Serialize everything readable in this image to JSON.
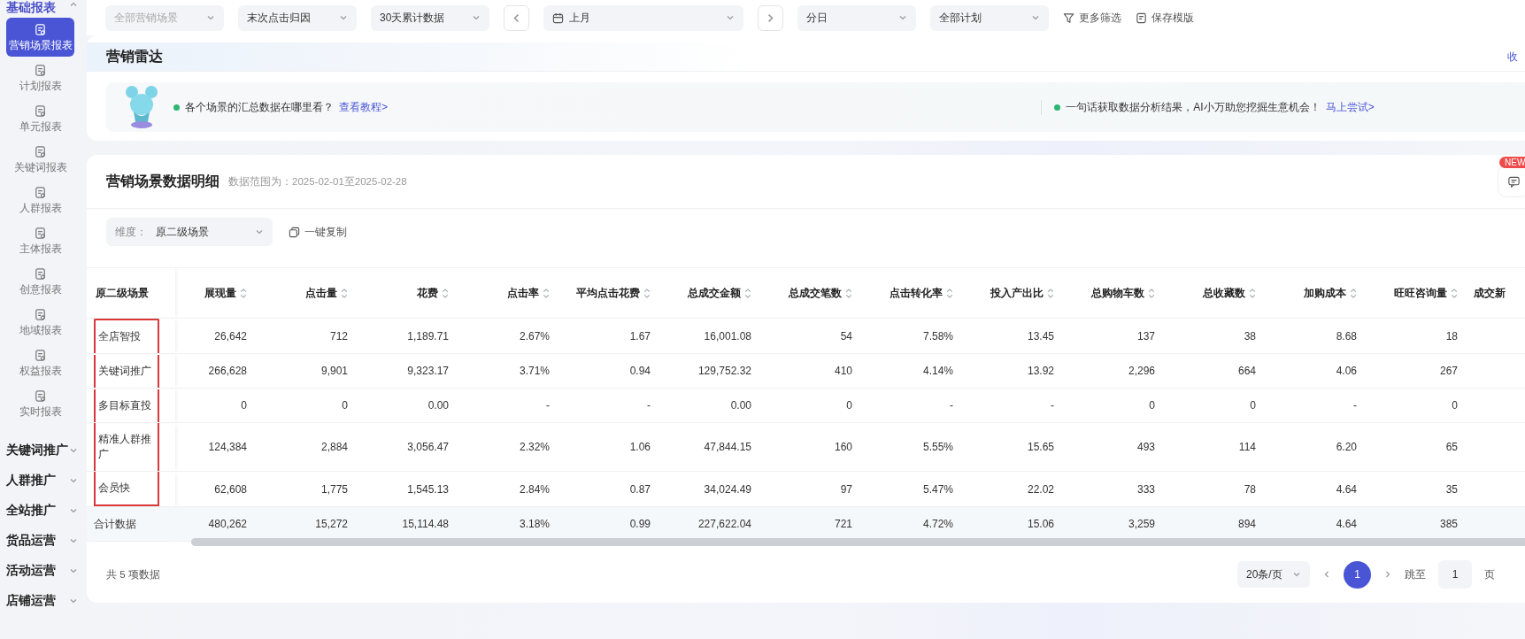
{
  "sidebar": {
    "groups": [
      {
        "label": "基础报表",
        "expanded": true,
        "items": [
          {
            "label": "营销场景报表",
            "selected": true
          },
          {
            "label": "计划报表",
            "selected": false
          },
          {
            "label": "单元报表",
            "selected": false
          },
          {
            "label": "关键词报表",
            "selected": false
          },
          {
            "label": "人群报表",
            "selected": false
          },
          {
            "label": "主体报表",
            "selected": false
          },
          {
            "label": "创意报表",
            "selected": false
          },
          {
            "label": "地域报表",
            "selected": false
          },
          {
            "label": "权益报表",
            "selected": false
          },
          {
            "label": "实时报表",
            "selected": false
          }
        ]
      },
      {
        "label": "关键词推广",
        "expanded": false
      },
      {
        "label": "人群推广",
        "expanded": false
      },
      {
        "label": "全站推广",
        "expanded": false
      },
      {
        "label": "货品运营",
        "expanded": false
      },
      {
        "label": "活动运营",
        "expanded": false
      },
      {
        "label": "店铺运营",
        "expanded": false
      }
    ]
  },
  "filters": [
    {
      "kind": "select",
      "value": "全部营销场景",
      "disabled": true
    },
    {
      "kind": "select",
      "value": "末次点击归因",
      "disabled": false
    },
    {
      "kind": "select",
      "value": "30天累计数据",
      "disabled": false
    },
    {
      "kind": "prev"
    },
    {
      "kind": "date",
      "value": "上月",
      "disabled": false
    },
    {
      "kind": "next"
    },
    {
      "kind": "select",
      "value": "分日",
      "disabled": false
    },
    {
      "kind": "select",
      "value": "全部计划",
      "disabled": false
    },
    {
      "kind": "filter",
      "label": "更多筛选"
    },
    {
      "kind": "save",
      "label": "保存模版"
    }
  ],
  "radar": {
    "title": "营销雷达",
    "collapse": "收",
    "tips": [
      {
        "text": "各个场景的汇总数据在哪里看？",
        "link": "查看教程>"
      },
      {
        "text": "一句话获取数据分析结果，AI小万助您挖掘生意机会！",
        "link": "马上尝试>"
      }
    ]
  },
  "detail": {
    "title": "营销场景数据明细",
    "range": "数据范围为：2025-02-01至2025-02-28",
    "badge": "NEW",
    "dimension": {
      "label": "维度：",
      "value": "原二级场景"
    },
    "copy": "一键复制",
    "table": {
      "columns": [
        {
          "label": "原二级场景",
          "sortable": false
        },
        {
          "label": "展现量",
          "sortable": true
        },
        {
          "label": "点击量",
          "sortable": true
        },
        {
          "label": "花费",
          "sortable": true
        },
        {
          "label": "点击率",
          "sortable": true
        },
        {
          "label": "平均点击花费",
          "sortable": true
        },
        {
          "label": "总成交金额",
          "sortable": true
        },
        {
          "label": "总成交笔数",
          "sortable": true
        },
        {
          "label": "点击转化率",
          "sortable": true
        },
        {
          "label": "投入产出比",
          "sortable": true
        },
        {
          "label": "总购物车数",
          "sortable": true
        },
        {
          "label": "总收藏数",
          "sortable": true
        },
        {
          "label": "加购成本",
          "sortable": true
        },
        {
          "label": "旺旺咨询量",
          "sortable": true
        },
        {
          "label": "成交新",
          "sortable": false
        }
      ],
      "rows": [
        {
          "scene": "全店智投",
          "highlighted": true,
          "values": [
            "26,642",
            "712",
            "1,189.71",
            "2.67%",
            "1.67",
            "16,001.08",
            "54",
            "7.58%",
            "13.45",
            "137",
            "38",
            "8.68",
            "18"
          ]
        },
        {
          "scene": "关键词推广",
          "highlighted": true,
          "values": [
            "266,628",
            "9,901",
            "9,323.17",
            "3.71%",
            "0.94",
            "129,752.32",
            "410",
            "4.14%",
            "13.92",
            "2,296",
            "664",
            "4.06",
            "267"
          ]
        },
        {
          "scene": "多目标直投",
          "highlighted": true,
          "values": [
            "0",
            "0",
            "0.00",
            "-",
            "-",
            "0.00",
            "0",
            "-",
            "-",
            "0",
            "0",
            "-",
            "0"
          ]
        },
        {
          "scene": "精准人群推广",
          "highlighted": true,
          "values": [
            "124,384",
            "2,884",
            "3,056.47",
            "2.32%",
            "1.06",
            "47,844.15",
            "160",
            "5.55%",
            "15.65",
            "493",
            "114",
            "6.20",
            "65"
          ]
        },
        {
          "scene": "会员快",
          "highlighted": true,
          "values": [
            "62,608",
            "1,775",
            "1,545.13",
            "2.84%",
            "0.87",
            "34,024.49",
            "97",
            "5.47%",
            "22.02",
            "333",
            "78",
            "4.64",
            "35"
          ]
        }
      ],
      "total": {
        "label": "合计数据",
        "values": [
          "480,262",
          "15,272",
          "15,114.48",
          "3.18%",
          "0.99",
          "227,622.04",
          "721",
          "4.72%",
          "15.06",
          "3,259",
          "894",
          "4.64",
          "385"
        ]
      }
    },
    "footer": {
      "count": "共 5 项数据",
      "page_size": "20条/页",
      "pages": [
        {
          "label": "1",
          "selected": true
        }
      ],
      "jump_label": "跳至",
      "jump_value": "1",
      "page_unit": "页"
    }
  }
}
